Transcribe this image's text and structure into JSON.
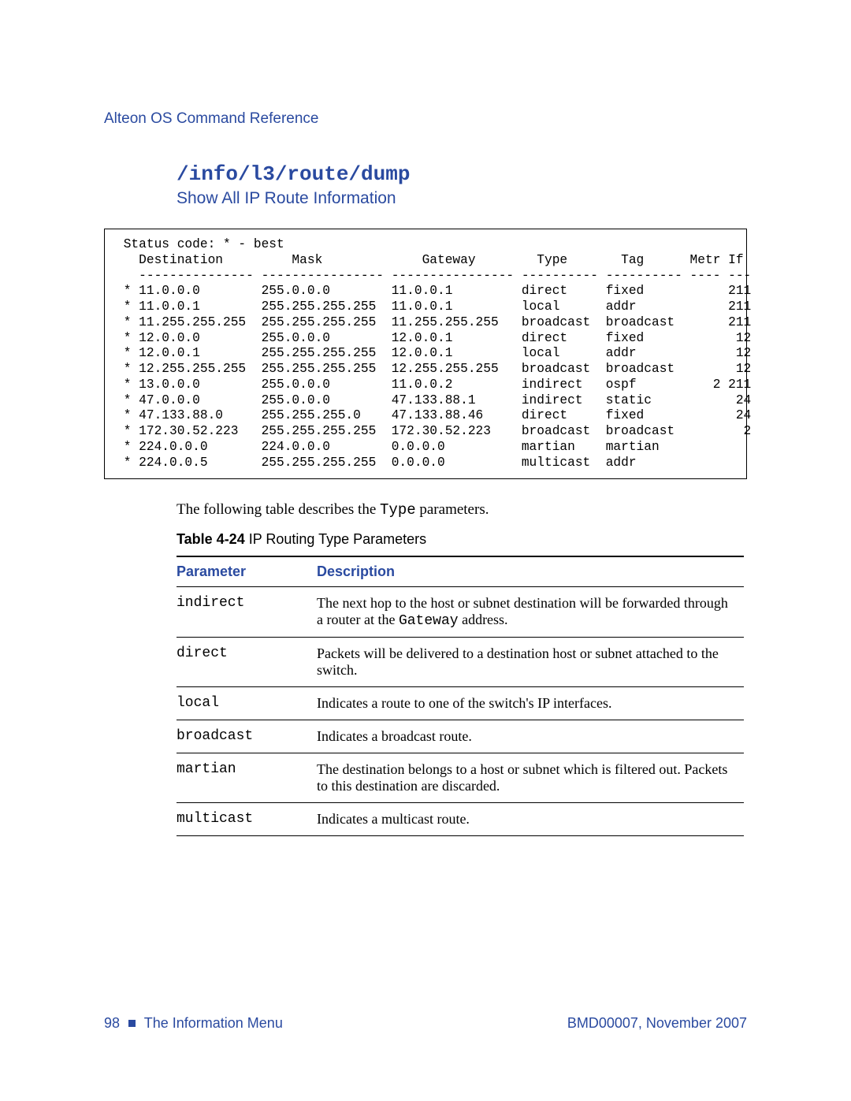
{
  "header": {
    "running": "Alteon OS Command Reference"
  },
  "title": {
    "cmd": "/info/l3/route/dump",
    "sub": "Show All IP Route Information"
  },
  "dump": {
    "status": "Status code: * - best",
    "cols": {
      "dest": "Destination",
      "mask": "Mask",
      "gw": "Gateway",
      "type": "Type",
      "tag": "Tag",
      "metr": "Metr",
      "if": "If"
    },
    "rows": [
      {
        "s": "*",
        "d": "11.0.0.0",
        "m": "255.0.0.0",
        "g": "11.0.0.1",
        "t": "direct",
        "tag": "fixed",
        "metr": "",
        "if": "211"
      },
      {
        "s": "*",
        "d": "11.0.0.1",
        "m": "255.255.255.255",
        "g": "11.0.0.1",
        "t": "local",
        "tag": "addr",
        "metr": "",
        "if": "211"
      },
      {
        "s": "*",
        "d": "11.255.255.255",
        "m": "255.255.255.255",
        "g": "11.255.255.255",
        "t": "broadcast",
        "tag": "broadcast",
        "metr": "",
        "if": "211"
      },
      {
        "s": "*",
        "d": "12.0.0.0",
        "m": "255.0.0.0",
        "g": "12.0.0.1",
        "t": "direct",
        "tag": "fixed",
        "metr": "",
        "if": "12"
      },
      {
        "s": "*",
        "d": "12.0.0.1",
        "m": "255.255.255.255",
        "g": "12.0.0.1",
        "t": "local",
        "tag": "addr",
        "metr": "",
        "if": "12"
      },
      {
        "s": "*",
        "d": "12.255.255.255",
        "m": "255.255.255.255",
        "g": "12.255.255.255",
        "t": "broadcast",
        "tag": "broadcast",
        "metr": "",
        "if": "12"
      },
      {
        "s": "*",
        "d": "13.0.0.0",
        "m": "255.0.0.0",
        "g": "11.0.0.2",
        "t": "indirect",
        "tag": "ospf",
        "metr": "2",
        "if": "211"
      },
      {
        "s": "*",
        "d": "47.0.0.0",
        "m": "255.0.0.0",
        "g": "47.133.88.1",
        "t": "indirect",
        "tag": "static",
        "metr": "",
        "if": "24"
      },
      {
        "s": "*",
        "d": "47.133.88.0",
        "m": "255.255.255.0",
        "g": "47.133.88.46",
        "t": "direct",
        "tag": "fixed",
        "metr": "",
        "if": "24"
      },
      {
        "s": "*",
        "d": "172.30.52.223",
        "m": "255.255.255.255",
        "g": "172.30.52.223",
        "t": "broadcast",
        "tag": "broadcast",
        "metr": "",
        "if": "2"
      },
      {
        "s": "*",
        "d": "224.0.0.0",
        "m": "224.0.0.0",
        "g": "0.0.0.0",
        "t": "martian",
        "tag": "martian",
        "metr": "",
        "if": ""
      },
      {
        "s": "*",
        "d": "224.0.0.5",
        "m": "255.255.255.255",
        "g": "0.0.0.0",
        "t": "multicast",
        "tag": "addr",
        "metr": "",
        "if": ""
      }
    ]
  },
  "intro": {
    "pre": "The following table describes the ",
    "code": "Type",
    "post": " parameters."
  },
  "table": {
    "caption_bold": "Table 4-24",
    "caption_rest": "  IP Routing Type Parameters",
    "hdr_param": "Parameter",
    "hdr_desc": "Description",
    "rows": [
      {
        "p": "indirect",
        "d_pre": "The next hop to the host or subnet destination will be forwarded through a router at the ",
        "d_code": "Gateway",
        "d_post": " address."
      },
      {
        "p": "direct",
        "d": "Packets will be delivered to a destination host or subnet attached to the switch."
      },
      {
        "p": "local",
        "d": "Indicates a route to one of the switch's IP interfaces."
      },
      {
        "p": "broadcast",
        "d": "Indicates a broadcast route."
      },
      {
        "p": "martian",
        "d": "The destination belongs to a host or subnet which is filtered out. Packets to this destination are discarded."
      },
      {
        "p": "multicast",
        "d": "Indicates a multicast route."
      }
    ]
  },
  "footer": {
    "page": "98",
    "section": "The Information Menu",
    "doc": "BMD00007, November 2007"
  }
}
